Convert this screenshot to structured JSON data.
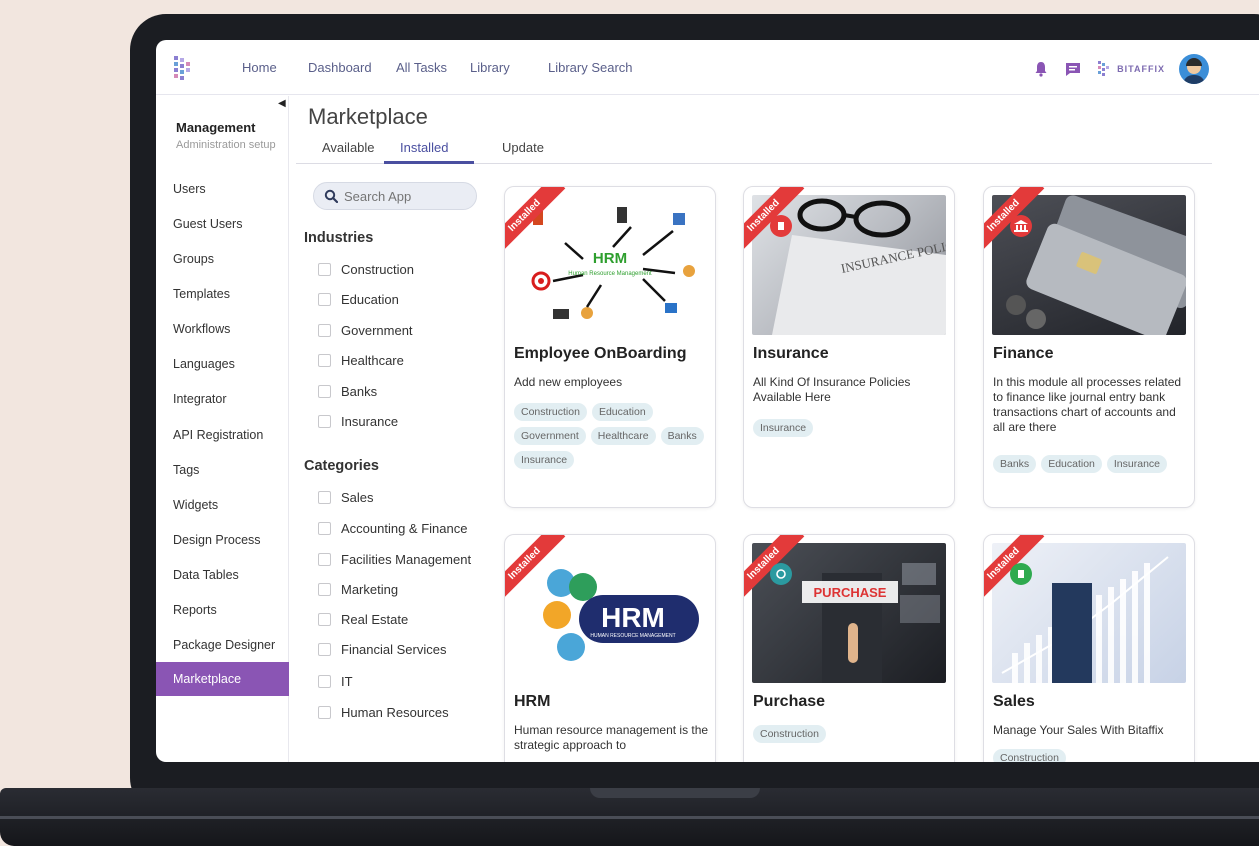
{
  "nav": {
    "links": [
      "Home",
      "Dashboard",
      "All Tasks",
      "Library",
      "Library Search"
    ],
    "brand": "BITAFFIX"
  },
  "sidebar": {
    "section_title": "Management",
    "section_subtitle": "Administration setup",
    "items": [
      "Users",
      "Guest Users",
      "Groups",
      "Templates",
      "Workflows",
      "Languages",
      "Integrator",
      "API Registration",
      "Tags",
      "Widgets",
      "Design Process",
      "Data Tables",
      "Reports",
      "Package Designer",
      "Marketplace"
    ],
    "active": "Marketplace"
  },
  "page": {
    "title": "Marketplace",
    "tabs": [
      "Available",
      "Installed",
      "Update"
    ],
    "active_tab": "Installed"
  },
  "filters": {
    "search_placeholder": "Search App",
    "industries_heading": "Industries",
    "industries": [
      "Construction",
      "Education",
      "Government",
      "Healthcare",
      "Banks",
      "Insurance"
    ],
    "categories_heading": "Categories",
    "categories": [
      "Sales",
      "Accounting & Finance",
      "Facilities Management",
      "Marketing",
      "Real Estate",
      "Financial Services",
      "IT",
      "Human Resources"
    ]
  },
  "ribbon_label": "Installed",
  "cards": [
    {
      "title": "Employee OnBoarding",
      "description": "Add new employees",
      "tags": [
        "Construction",
        "Education",
        "Government",
        "Healthcare",
        "Banks",
        "Insurance"
      ],
      "image_text": "HRM",
      "image_subtext": "Human Resource Management"
    },
    {
      "title": "Insurance",
      "description": "All Kind Of Insurance Policies Available Here",
      "tags": [
        "Insurance"
      ],
      "image_text": "INSURANCE POLICY"
    },
    {
      "title": "Finance",
      "description": "In this module all processes related to finance like journal entry bank transactions chart of accounts and all are there",
      "tags": [
        "Banks",
        "Education",
        "Insurance"
      ]
    },
    {
      "title": "HRM",
      "description": "Human resource management is the strategic approach to",
      "tags": [],
      "image_text": "HRM",
      "image_subtext": "HUMAN RESOURCE MANAGEMENT"
    },
    {
      "title": "Purchase",
      "description": "",
      "tags": [
        "Construction"
      ],
      "image_text": "PURCHASE"
    },
    {
      "title": "Sales",
      "description": "Manage Your Sales With Bitaffix",
      "tags": [
        "Construction"
      ]
    }
  ],
  "colors": {
    "accent": "#8a55b4",
    "tab_active": "#4a4fa0",
    "ribbon": "#e33a3a",
    "tag_bg": "#e2eef2"
  }
}
